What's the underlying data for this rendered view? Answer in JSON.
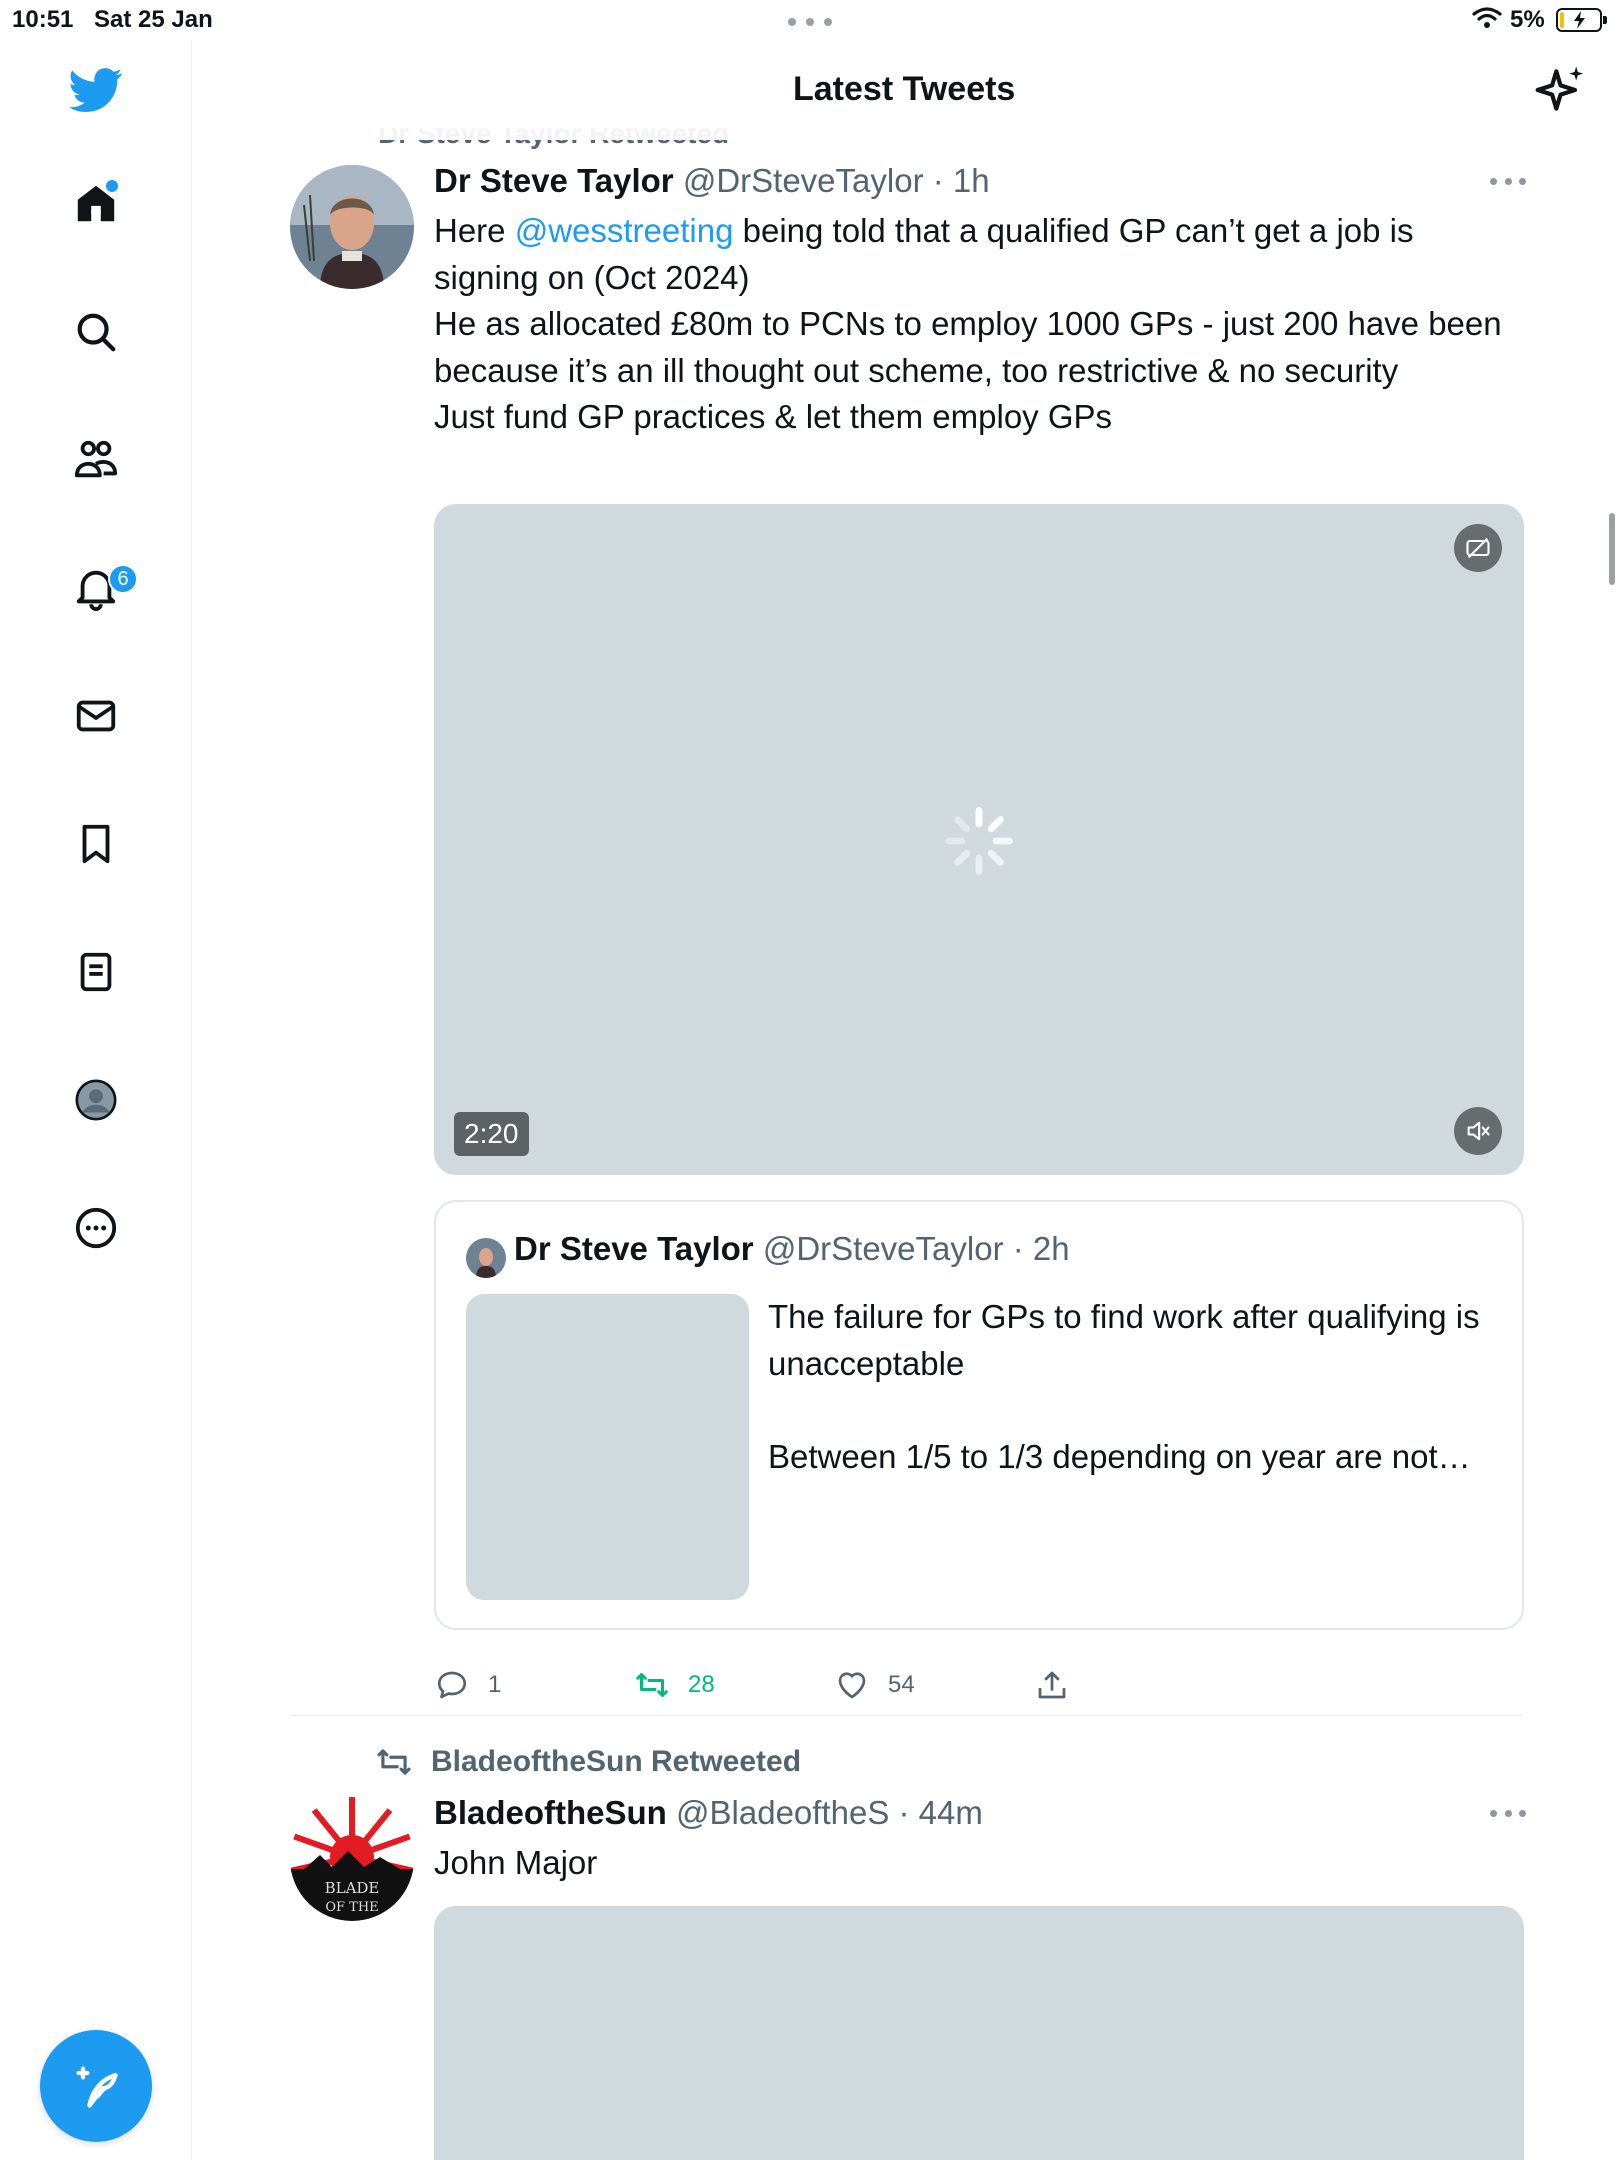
{
  "status_bar": {
    "time": "10:51",
    "date": "Sat 25 Jan",
    "battery": "5%"
  },
  "header": {
    "title": "Latest Tweets"
  },
  "sidebar": {
    "items": [
      {
        "name": "home",
        "icon": "home-icon"
      },
      {
        "name": "explore",
        "icon": "search-icon"
      },
      {
        "name": "communities",
        "icon": "communities-icon"
      },
      {
        "name": "notifications",
        "icon": "bell-icon",
        "badge": "6"
      },
      {
        "name": "messages",
        "icon": "mail-icon"
      },
      {
        "name": "bookmarks",
        "icon": "bookmark-icon"
      },
      {
        "name": "lists",
        "icon": "lists-icon"
      },
      {
        "name": "profile",
        "icon": "avatar-icon"
      },
      {
        "name": "more",
        "icon": "more-icon"
      }
    ],
    "compose_icon": "compose-tweet-icon"
  },
  "ghost_retweet": "Dr Steve Taylor Retweeted",
  "tweets": [
    {
      "name": "Dr Steve Taylor",
      "handle": "@DrSteveTaylor",
      "time": "· 1h",
      "body_prefix": "Here ",
      "mention": "@wesstreeting",
      "body_l1": " being told that a qualified GP can’t get a job is signing on (Oct 2024)",
      "body_l2": "He as allocated £80m to PCNs to employ 1000 GPs - just 200 have been because it’s an ill thought out scheme, too restrictive & no security",
      "body_l3": "Just fund GP practices & let them employ GPs",
      "video_duration": "2:20",
      "quote": {
        "name": "Dr Steve Taylor",
        "handle": "@DrSteveTaylor",
        "time": "· 2h",
        "text1": "The failure for GPs to find work after qualifying is unacceptable",
        "text2": "Between 1/5 to 1/3 depending on year are not…"
      },
      "actions": {
        "replies": "1",
        "retweets": "28",
        "likes": "54"
      }
    },
    {
      "retweeted_by": "BladeoftheSun Retweeted",
      "name": "BladeoftheSun",
      "handle": "@BladeoftheS",
      "time": "· 44m",
      "body": "John Major"
    }
  ],
  "colors": {
    "accent": "#1d9bf0",
    "retweet_green": "#00ba7c",
    "media_placeholder": "#cfd9de",
    "muted_text": "#536471"
  }
}
